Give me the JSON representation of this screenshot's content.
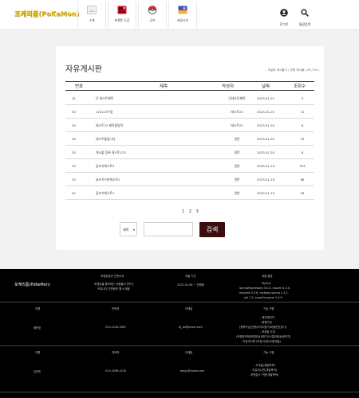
{
  "nav": {
    "logo": "포케리폼(PoKeMon)",
    "items": [
      {
        "label": "소개"
      },
      {
        "label": "포켓몬 도감"
      },
      {
        "label": "굿즈"
      },
      {
        "label": "커뮤니티"
      }
    ],
    "right": [
      {
        "label": "로그인",
        "icon": "user-icon"
      },
      {
        "label": "통합검색",
        "icon": "search-icon"
      }
    ]
  },
  "board": {
    "title": "자유게시판",
    "count_text": "오늘의 게시물 0 / 전체 게시물 ( 29 / 29 )",
    "columns": [
      "번호",
      "제목",
      "작성자",
      "날짜",
      "조회수"
    ],
    "rows": [
      {
        "no": "31",
        "title": "단 테스트제목",
        "author": "단테스트제목",
        "date": "2023-01-21",
        "views": "3"
      },
      {
        "no": "30",
        "title": "123123수정",
        "author": "테스트23",
        "date": "2023-01-20",
        "views": "11"
      },
      {
        "no": "29",
        "title": "테스트23 제목들입력",
        "author": "테스트23",
        "date": "2023-01-20",
        "views": "6"
      },
      {
        "no": "26",
        "title": "테스트물업나다",
        "author": "일반",
        "date": "2023-01-20",
        "views": "19"
      },
      {
        "no": "25",
        "title": "게시물 등록 테스트123",
        "author": "일반",
        "date": "2023-01-20",
        "views": "8"
      },
      {
        "no": "24",
        "title": "글쓰기테스트3",
        "author": "일반",
        "date": "2023-01-19",
        "views": "203"
      },
      {
        "no": "23",
        "title": "글쓰기스판테스트2",
        "author": "일반",
        "date": "2023-01-19",
        "views": "86"
      },
      {
        "no": "22",
        "title": "글쓰기테스트1",
        "author": "일반",
        "date": "2023-01-19",
        "views": "59"
      }
    ],
    "pages": [
      "1",
      "2",
      "3"
    ],
    "search": {
      "select_value": "제목",
      "button_label": "검색"
    }
  },
  "footer": {
    "brand": "포케리폼(PoKeMon)",
    "col_headers": [
      "포켓몬팀과 간편소개",
      "개발 기간",
      "개발 환경"
    ],
    "intro_lines": [
      "포켓몬을 좋아하는 사람들이 만드는",
      "커뮤니티 간편정보 웹 소개될"
    ],
    "period": "2022.01.06 ~ 진행중",
    "env_lines": [
      "MySQL",
      "SpringFramework 5.0.6, maven 4.0.0,",
      "mybatis 3.5.6, mybatis-spring 1.3.2,",
      "jstl 1.2, superCsvserer 1.0.9"
    ],
    "members": [
      {
        "label_name": "이름",
        "label_phone": "연락처",
        "label_mail": "이메일",
        "label_role": "기능 구현",
        "name": "배준호",
        "phone": "010-1234-5647",
        "mail": "bj_bz@naver.com",
        "roles": [
          "- 메인페이지",
          "- 회원가입",
          "(중복가입/인증/아이디찾기/비밀번호찾기)",
          "- 포켓몬 도감",
          "(포켓몬조회/포켓몬상세보기/스킬조회/상세보기)",
          "- 자유게시판 (작성/수정/삭제/댓글)"
        ]
      },
      {
        "label_name": "이름",
        "label_phone": "연락처",
        "label_mail": "이메일",
        "label_role": "기능 구현",
        "name": "유찬민",
        "phone": "010-5298-4145",
        "mail": "banjy@naver.com",
        "roles": [
          "- 소개글(개발목적)",
          "- 자유게시판(개발목적)",
          "- 포켓몬스 구현(개발목적)"
        ]
      }
    ]
  },
  "colors": {
    "accent": "#3d0d0d",
    "logo": "#f2c60a",
    "footer_bg": "#000000"
  }
}
